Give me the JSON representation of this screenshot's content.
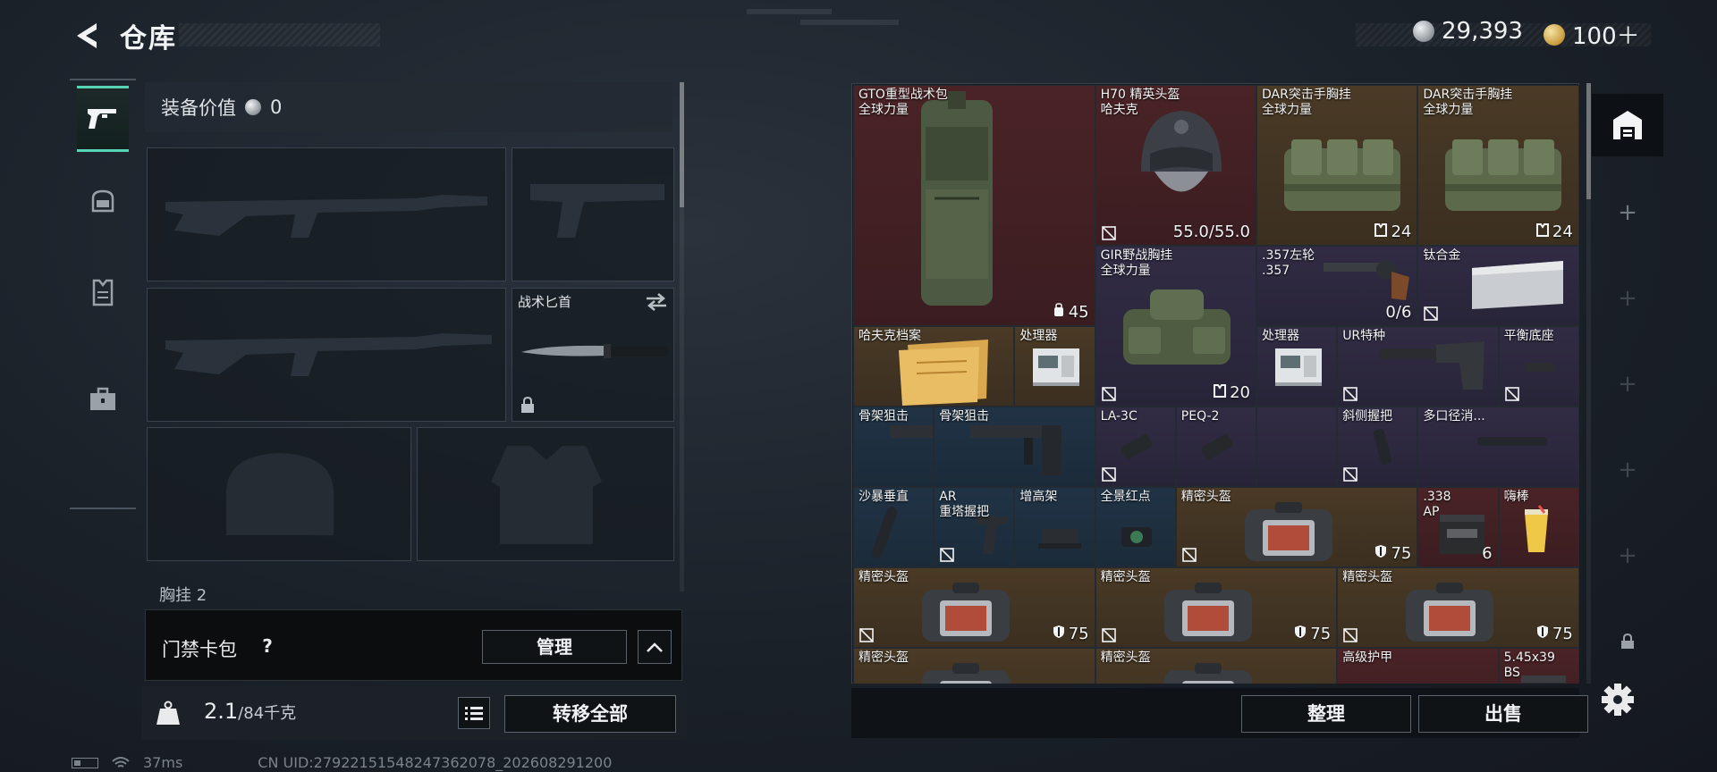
{
  "header": {
    "title": "仓库"
  },
  "currency": {
    "silver": "29,393",
    "gold": "100＋"
  },
  "equipment": {
    "value_label": "装备价值",
    "value": "0",
    "knife_label": "战术匕首",
    "vest_partial_label": "胸挂",
    "vest_partial_count": "2"
  },
  "keycard": {
    "label": "门禁卡包",
    "help": "?",
    "manage_label": "管理"
  },
  "weight": {
    "current": "2.1",
    "max": "/84千克"
  },
  "transfer_all_label": "转移全部",
  "status": {
    "ping": "37ms",
    "uid": "CN UID:279221515482473620​78_202608291200"
  },
  "stash_items": [
    {
      "name": "GTO重型战术包",
      "sub": "全球力量",
      "value": "45",
      "rarity": "red"
    },
    {
      "name": "H70 精英头盔",
      "sub": "哈夫克",
      "value": "55.0/55.0",
      "rarity": "red"
    },
    {
      "name": "DAR突击手胸挂",
      "sub": "全球力量",
      "value": "24",
      "rarity": "gold"
    },
    {
      "name": "DAR突击手胸挂",
      "sub": "全球力量",
      "value": "24",
      "rarity": "gold"
    },
    {
      "name": "GIR野战胸挂",
      "sub": "全球力量",
      "value": "20",
      "rarity": "purple"
    },
    {
      "name": ".357左轮",
      "sub": ".357",
      "value": "0/6",
      "rarity": "purple"
    },
    {
      "name": "钛合金",
      "sub": "",
      "value": "",
      "rarity": "purple"
    },
    {
      "name": "哈夫克档案",
      "sub": "",
      "value": "",
      "rarity": "gold"
    },
    {
      "name": "处理器",
      "sub": "",
      "value": "",
      "rarity": "gold"
    },
    {
      "name": "处理器",
      "sub": "",
      "value": "",
      "rarity": "purple"
    },
    {
      "name": "UR特种",
      "sub": "",
      "value": "",
      "rarity": "purple"
    },
    {
      "name": "平衡底座",
      "sub": "",
      "value": "",
      "rarity": "purple"
    },
    {
      "name": "骨架狙击",
      "sub": "",
      "value": "",
      "rarity": "blue"
    },
    {
      "name": "骨架狙击",
      "sub": "",
      "value": "",
      "rarity": "blue"
    },
    {
      "name": "LA-3C",
      "sub": "",
      "value": "",
      "rarity": "purple"
    },
    {
      "name": "PEQ-2",
      "sub": "",
      "value": "",
      "rarity": "purple"
    },
    {
      "name": "",
      "sub": "",
      "value": "",
      "rarity": "purple"
    },
    {
      "name": "斜侧握把",
      "sub": "",
      "value": "",
      "rarity": "purple"
    },
    {
      "name": "多口径消...",
      "sub": "",
      "value": "",
      "rarity": "purple"
    },
    {
      "name": "沙暴垂直",
      "sub": "",
      "value": "",
      "rarity": "blue"
    },
    {
      "name": "AR",
      "sub": "重塔握把",
      "value": "",
      "rarity": "blue"
    },
    {
      "name": "增高架",
      "sub": "",
      "value": "",
      "rarity": "blue"
    },
    {
      "name": "全景红点",
      "sub": "",
      "value": "",
      "rarity": "blue"
    },
    {
      "name": "精密头盔",
      "sub": "",
      "value": "75",
      "rarity": "gold"
    },
    {
      "name": ".338",
      "sub": "AP",
      "value": "6",
      "rarity": "red"
    },
    {
      "name": "嗨棒",
      "sub": "",
      "value": "",
      "rarity": "red"
    },
    {
      "name": "精密头盔",
      "sub": "",
      "value": "75",
      "rarity": "gold"
    },
    {
      "name": "精密头盔",
      "sub": "",
      "value": "75",
      "rarity": "gold"
    },
    {
      "name": "精密头盔",
      "sub": "",
      "value": "75",
      "rarity": "gold"
    },
    {
      "name": "精密头盔",
      "sub": "",
      "value": "",
      "rarity": "gold"
    },
    {
      "name": "精密头盔",
      "sub": "",
      "value": "",
      "rarity": "gold"
    },
    {
      "name": "高级护甲",
      "sub": "",
      "value": "",
      "rarity": "red"
    },
    {
      "name": "5.45x39",
      "sub": "BS",
      "value": "",
      "rarity": "red"
    }
  ],
  "actions": {
    "sort_label": "整理",
    "sell_label": "出售"
  },
  "icons": [
    "back-arrow-icon",
    "weapon-tab-icon",
    "helmet-tab-icon",
    "vest-tab-icon",
    "case-tab-icon",
    "stash-icon",
    "plus-icon",
    "lock-icon",
    "settings-icon",
    "list-icon",
    "weight-icon",
    "chevron-up-icon",
    "swap-icon"
  ]
}
